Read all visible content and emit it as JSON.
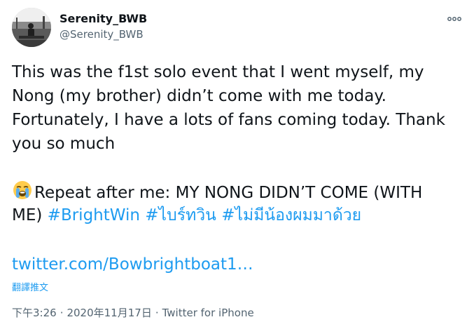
{
  "author": {
    "display_name": "Serenity_BWB",
    "handle": "@Serenity_BWB"
  },
  "tweet": {
    "lines": [
      "This was the f1st solo event that I went myself, my",
      "Nong (my brother) didn’t come with me today.",
      "Fortunately, I have a lots of fans coming today. Thank",
      "you so much"
    ],
    "repeat_text": "Repeat after me: MY NONG DIDN’T COME (WITH",
    "repeat_text_cont": "ME)",
    "hashtags": [
      "#BrightWin",
      "#ไบร์ทวิน",
      "#ไม่มีน้องผมมาด้วย"
    ],
    "link": "twitter.com/Bowbrightboat1…",
    "translate_label": "翻譯推文"
  },
  "meta": {
    "time": "下午3:26",
    "separator": "·",
    "date": "2020年11月17日",
    "source": "Twitter for iPhone"
  },
  "icons": {
    "avatar": "user-avatar-photo",
    "more": "more-options-icon",
    "emoji": "loudly-crying-face-emoji"
  },
  "colors": {
    "link_blue": "#1d9bf0",
    "text": "#0f1419",
    "muted": "#536471"
  }
}
